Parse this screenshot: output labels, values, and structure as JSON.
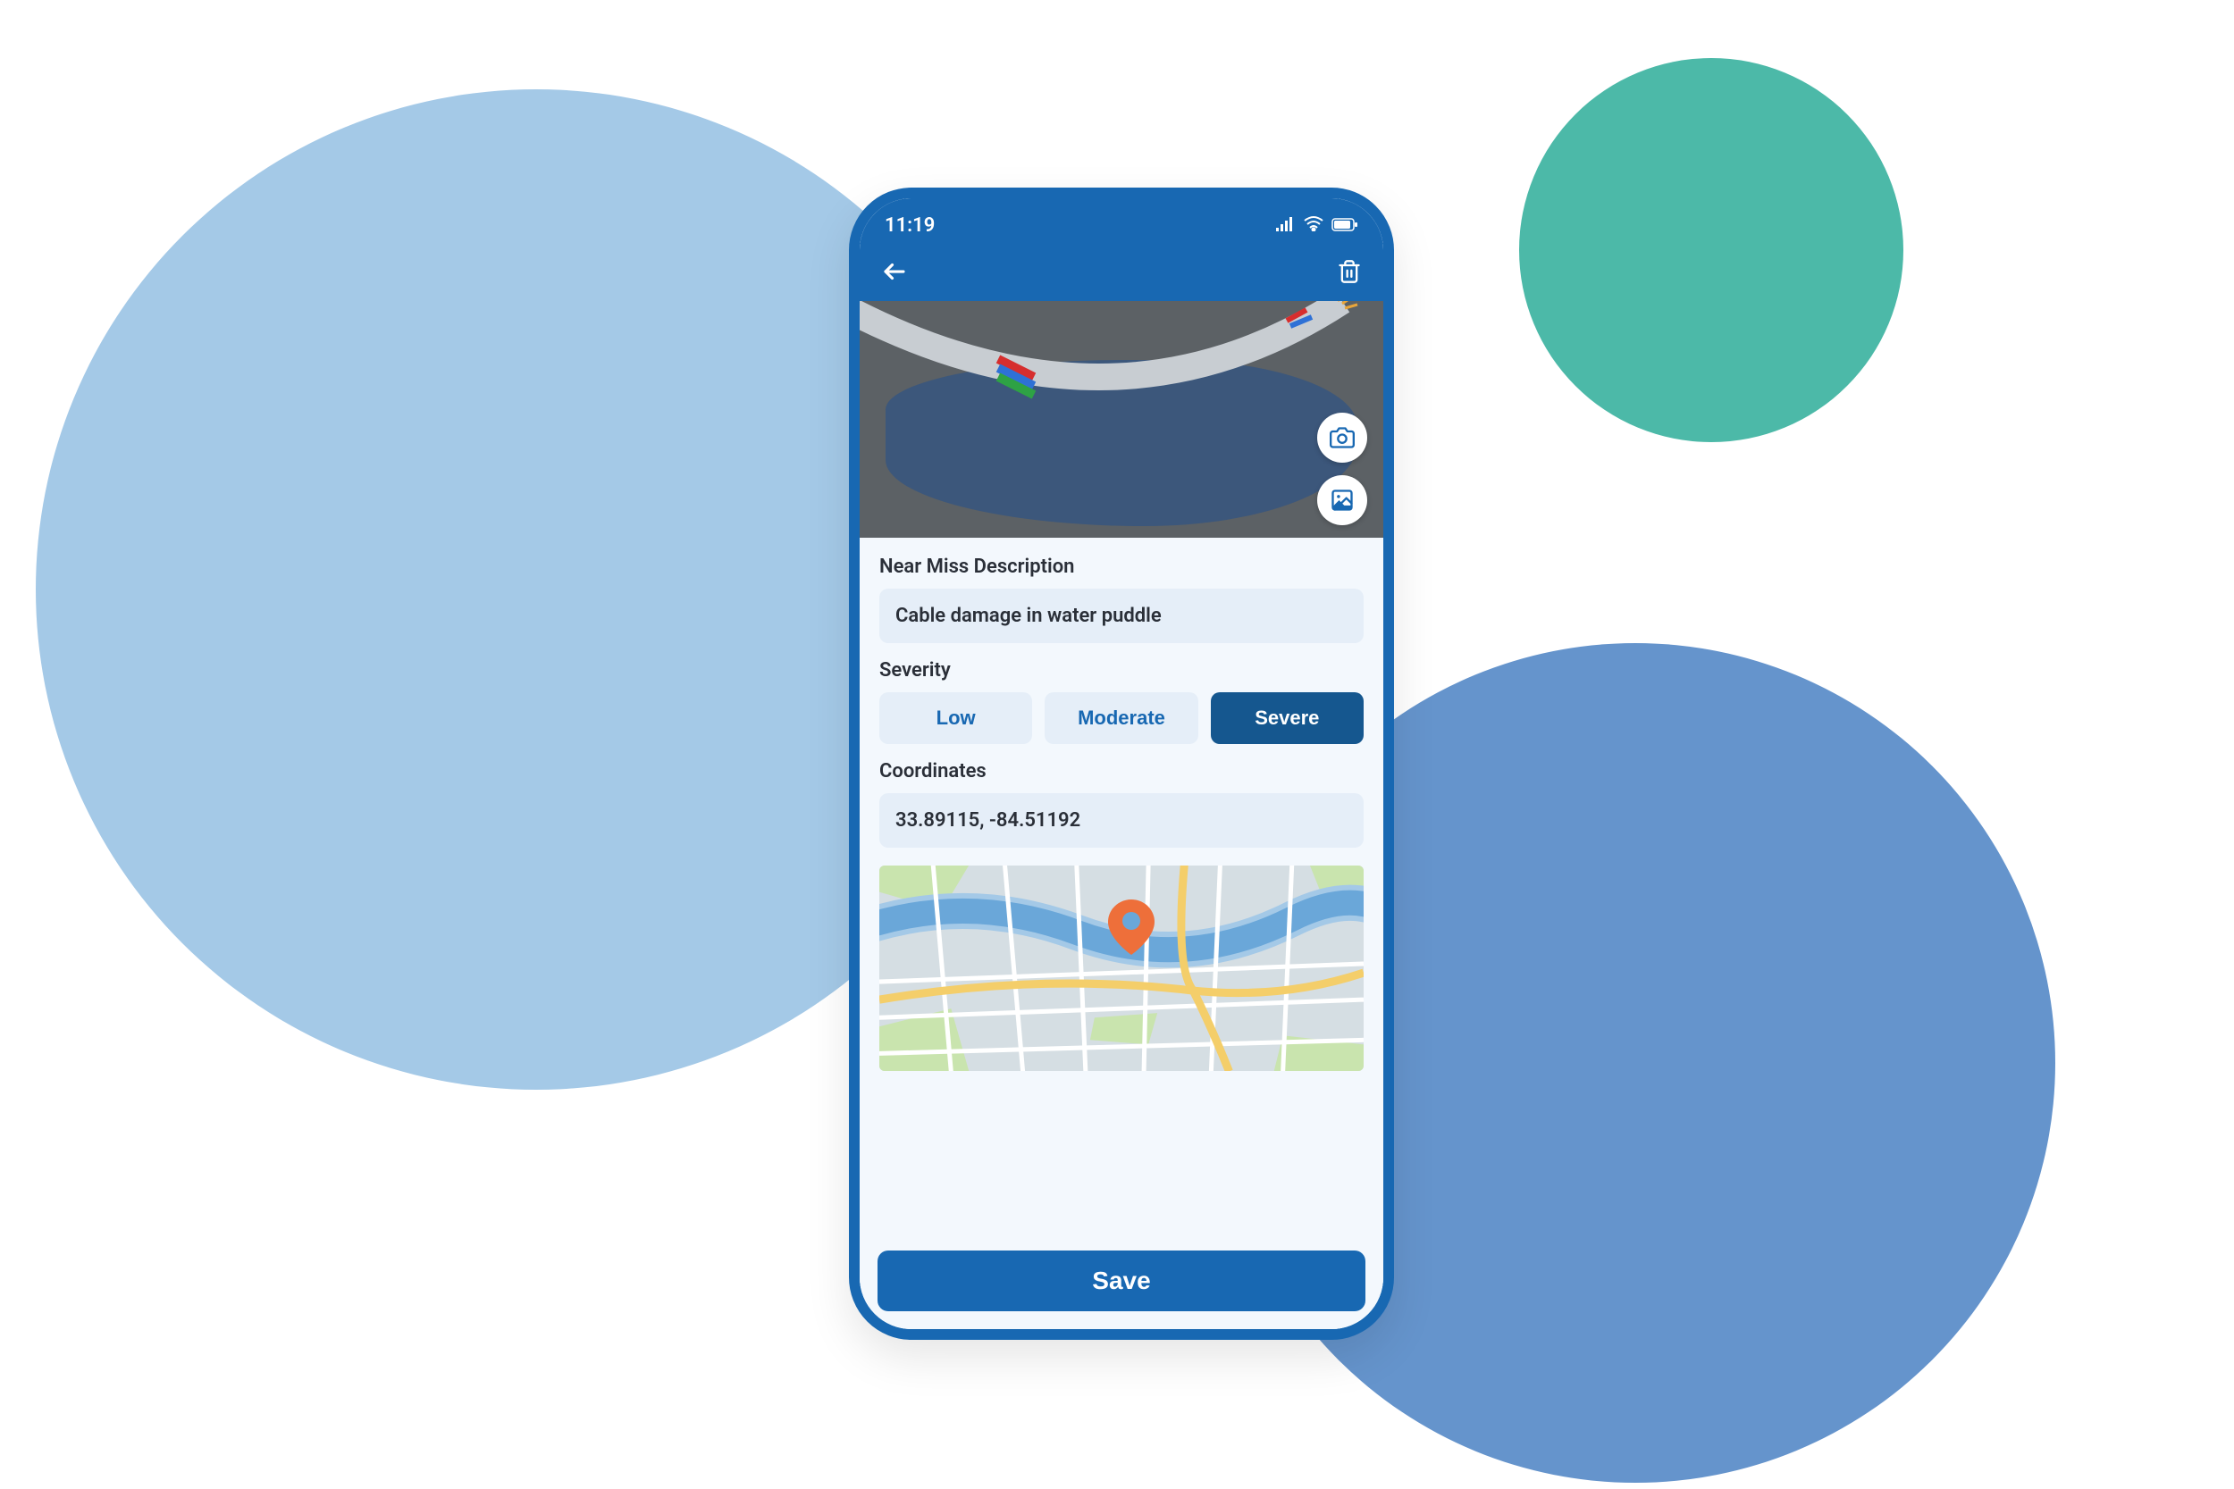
{
  "status_bar": {
    "time": "11:19",
    "signal_icon": "signal-icon",
    "wifi_icon": "wifi-icon",
    "battery_icon": "battery-icon"
  },
  "nav": {
    "back_icon": "arrow-left-icon",
    "delete_icon": "trash-icon"
  },
  "hero": {
    "camera_icon": "camera-icon",
    "gallery_icon": "image-icon"
  },
  "form": {
    "description_label": "Near Miss Description",
    "description_value": "Cable damage in water puddle",
    "severity_label": "Severity",
    "severity_options": [
      {
        "label": "Low",
        "selected": false
      },
      {
        "label": "Moderate",
        "selected": false
      },
      {
        "label": "Severe",
        "selected": true
      }
    ],
    "coordinates_label": "Coordinates",
    "coordinates_value": "33.89115, -84.51192"
  },
  "save_label": "Save"
}
